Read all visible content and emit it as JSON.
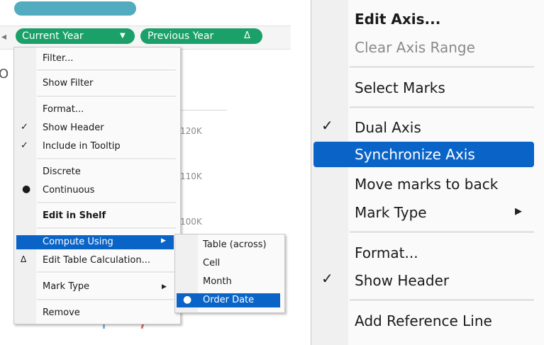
{
  "shelf": {
    "pill_current": "Current Year",
    "pill_previous": "Previous Year"
  },
  "axis_ticks": [
    "120K",
    "110K",
    "100K"
  ],
  "context_menu": {
    "items": [
      {
        "label": "Filter..."
      },
      {
        "label": "Show Filter"
      },
      {
        "label": "Format..."
      },
      {
        "label": "Show Header",
        "checked": true
      },
      {
        "label": "Include in Tooltip",
        "checked": true
      },
      {
        "label": "Discrete"
      },
      {
        "label": "Continuous",
        "selected": true
      },
      {
        "label": "Edit in Shelf",
        "bold": true
      },
      {
        "label": "Compute Using",
        "highlighted": true,
        "submenu": true
      },
      {
        "label": "Edit Table Calculation...",
        "icon": "delta-icon"
      },
      {
        "label": "Mark Type",
        "submenu": true
      },
      {
        "label": "Remove"
      }
    ]
  },
  "compute_using_submenu": {
    "items": [
      {
        "label": "Table (across)"
      },
      {
        "label": "Cell"
      },
      {
        "label": "Month"
      },
      {
        "label": "Order Date",
        "selected": true,
        "highlighted": true
      }
    ]
  },
  "axis_menu": {
    "items": [
      {
        "label": "Edit Axis...",
        "bold": true
      },
      {
        "label": "Clear Axis Range",
        "disabled": true
      },
      {
        "label": "Select Marks"
      },
      {
        "label": "Dual Axis",
        "checked": true
      },
      {
        "label": "Synchronize Axis",
        "highlighted": true
      },
      {
        "label": "Move marks to back"
      },
      {
        "label": "Mark Type",
        "submenu": true
      },
      {
        "label": "Format..."
      },
      {
        "label": "Show Header",
        "checked": true
      },
      {
        "label": "Add Reference Line"
      }
    ]
  },
  "colors": {
    "pill_green": "#1aa068",
    "highlight_blue": "#0a64c8"
  }
}
